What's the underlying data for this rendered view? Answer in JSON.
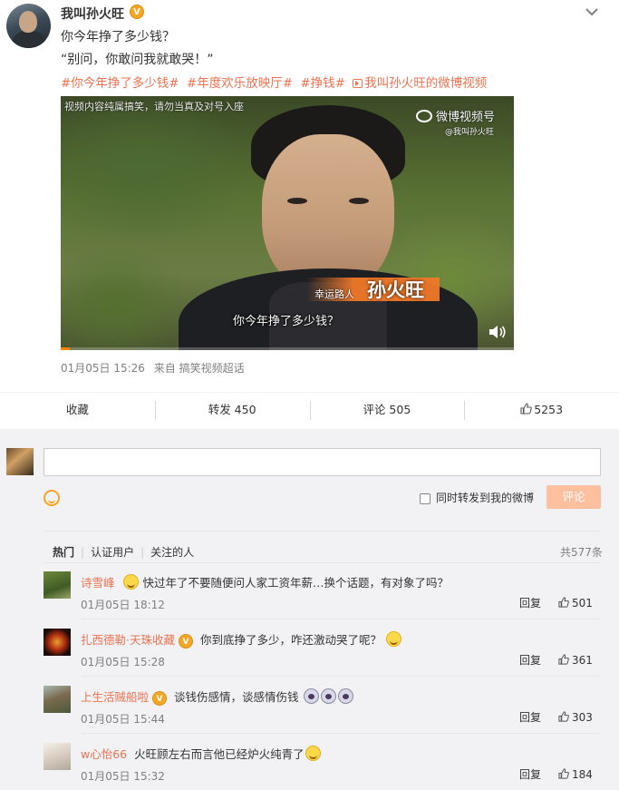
{
  "post": {
    "username": "我叫孙火旺",
    "verified_badge": "V",
    "line1": "你今年挣了多少钱？",
    "line2": "“别问，你敢问我就敢哭！”",
    "tags": [
      "#你今年挣了多少钱#",
      "#年度欢乐放映厅#",
      "#挣钱#"
    ],
    "video_link": "我叫孙火旺的微博视频",
    "video_link_icon": "video-link-icon",
    "video": {
      "top_left_notice": "视频内容纯属搞笑，请勿当真及对号入座",
      "logo": "微博视频号",
      "logo_sub": "@我叫孙火旺",
      "label_small": "幸运路人",
      "label_name": "孙火旺",
      "subtitle": "你今年挣了多少钱？",
      "progress": 0.02
    },
    "date": "01月05日 15:26",
    "source": "来自 搞笑视频超话"
  },
  "actions": {
    "collect": "收藏",
    "forward": "转发 450",
    "comment": "评论 505",
    "like_count": "5253"
  },
  "composer": {
    "emoji_icon": "smiley-icon",
    "forward_label": "同时转发到我的微博",
    "submit": "评论"
  },
  "comment_tabs": {
    "hot": "热门",
    "verified": "认证用户",
    "following": "关注的人",
    "total": "共577条"
  },
  "comments": [
    {
      "name": "诗雪峰",
      "badge": "",
      "text": "快过年了不要随便问人家工资年薪…换个话题，有对象了吗？",
      "time": "01月05日 18:12",
      "reply": "回复",
      "likes": "501"
    },
    {
      "name": "扎西德勒·天珠收藏",
      "badge": "V",
      "text": "你到底挣了多少，咋还激动哭了呢？",
      "time": "01月05日 15:28",
      "reply": "回复",
      "likes": "361"
    },
    {
      "name": "上生活贼船啦",
      "badge": "V",
      "text": "谈钱伤感情，谈感情伤钱",
      "time": "01月05日 15:44",
      "reply": "回复",
      "likes": "303"
    },
    {
      "name": "w心怡66",
      "badge": "",
      "text": "火旺顾左右而言他已经炉火纯青了",
      "time": "01月05日 15:32",
      "reply": "回复",
      "likes": "184"
    }
  ],
  "colors": {
    "accent": "#eb7350",
    "submit_bg": "#ffc09f",
    "progress": "#ff8200",
    "comments_bg": "#f2f2f5"
  }
}
